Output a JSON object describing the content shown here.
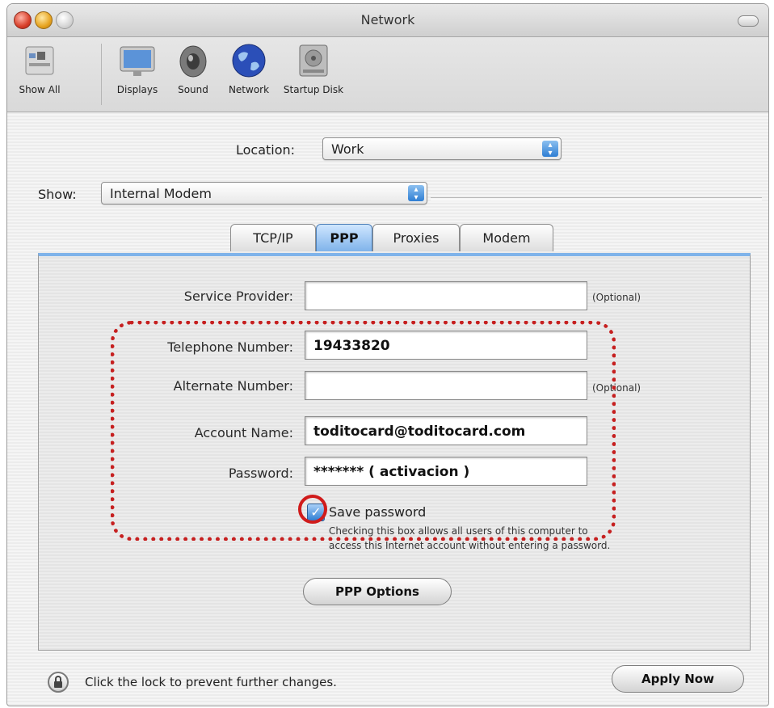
{
  "window": {
    "title": "Network"
  },
  "toolbar": {
    "items": [
      {
        "label": "Show All",
        "icon": "show-all-icon"
      },
      {
        "label": "Displays",
        "icon": "display-icon"
      },
      {
        "label": "Sound",
        "icon": "speaker-icon"
      },
      {
        "label": "Network",
        "icon": "globe-icon"
      },
      {
        "label": "Startup Disk",
        "icon": "disk-icon"
      }
    ]
  },
  "location": {
    "label": "Location:",
    "value": "Work"
  },
  "show": {
    "label": "Show:",
    "value": "Internal Modem"
  },
  "tabs": [
    {
      "label": "TCP/IP",
      "selected": false
    },
    {
      "label": "PPP",
      "selected": true
    },
    {
      "label": "Proxies",
      "selected": false
    },
    {
      "label": "Modem",
      "selected": false
    }
  ],
  "form": {
    "service_provider": {
      "label": "Service Provider:",
      "value": "",
      "note": "(Optional)"
    },
    "telephone": {
      "label": "Telephone Number:",
      "value": "19433820"
    },
    "alternate": {
      "label": "Alternate Number:",
      "value": "",
      "note": "(Optional)"
    },
    "account": {
      "label": "Account Name:",
      "value": "toditocard@toditocard.com"
    },
    "password": {
      "label": "Password:",
      "masked": "*******",
      "value": "( activacion )"
    },
    "save_password": {
      "label": "Save password",
      "checked": true,
      "help_line1": "Checking this box allows all users of this computer to",
      "help_line2": "access this Internet account without entering a password."
    },
    "ppp_options_label": "PPP Options"
  },
  "footer": {
    "lock_text": "Click the lock to prevent further changes.",
    "apply_label": "Apply Now"
  },
  "colors": {
    "accent": "#2f7ed3",
    "highlight": "#c62020"
  }
}
